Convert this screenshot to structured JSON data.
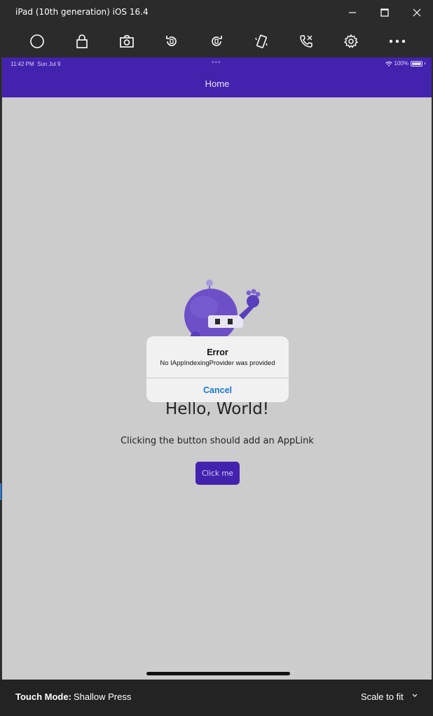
{
  "window": {
    "title": "iPad (10th generation) iOS 16.4",
    "minimize_icon": "minimize-icon",
    "maximize_icon": "maximize-icon",
    "close_icon": "close-icon"
  },
  "toolbar": {
    "items": [
      "home-button-icon",
      "lock-icon",
      "screenshot-camera-icon",
      "rotate-left-icon",
      "rotate-right-icon",
      "shake-icon",
      "phone-call-icon",
      "settings-gear-icon",
      "more-icon"
    ]
  },
  "statusbar": {
    "time": "11:42 PM",
    "date": "Sun Jul 9",
    "dots": "•••",
    "battery": "100%"
  },
  "app": {
    "nav_title": "Home",
    "headline": "Hello, World!",
    "description": "Clicking the button should add an AppLink",
    "button_label": "Click me",
    "accent_color": "#4322ae"
  },
  "alert": {
    "title": "Error",
    "message": "No IAppIndexingProvider was provided",
    "cancel_label": "Cancel"
  },
  "bottombar": {
    "touch_mode_label": "Touch Mode:",
    "touch_mode_value": "Shallow Press",
    "scale_label": "Scale to fit"
  }
}
